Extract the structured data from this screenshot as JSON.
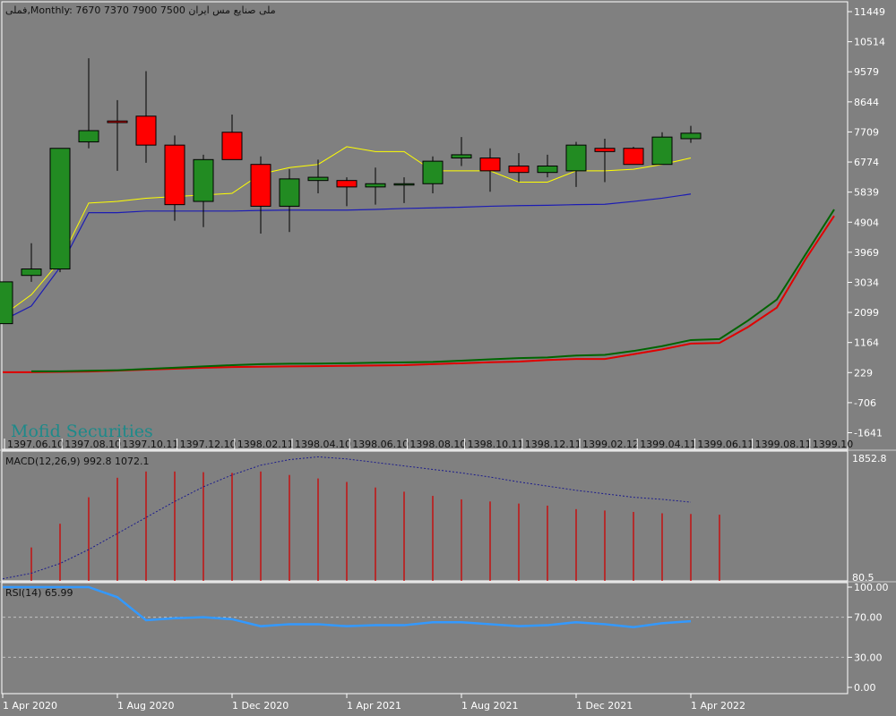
{
  "window": {
    "symbol_title": "فملی,Monthly:  7670 7370 7900 7500  ملی صنایع مس ایران",
    "watermark": "Mofid Securities"
  },
  "colors": {
    "background": "#808080",
    "bull": "#228b22",
    "bear": "#ff0000",
    "ma_fast": "#ffff00",
    "ma_slow": "#1c1cb4",
    "upper_bands_top": "#006400",
    "upper_bands_bottom": "#e00000",
    "macd_hist": "#cc0000",
    "macd_signal": "#1c1c8c",
    "rsi": "#3399ff"
  },
  "chart_data": [
    {
      "type": "candlestick",
      "panel": "price",
      "ylim": [
        -2100,
        11700
      ],
      "y_ticks": [
        11449,
        10514,
        9579,
        8644,
        7709,
        6774,
        5839,
        4904,
        3969,
        3034,
        2099,
        1164,
        229,
        -706,
        -1641
      ],
      "jalali_date_labels": [
        "1397.06.10",
        "1397.08.10",
        "1397.10.11",
        "1397.12.10",
        "1398.02.11",
        "1398.04.10",
        "1398.06.10",
        "1398.08.10",
        "1398.10.11",
        "1398.12.11",
        "1399.02.12",
        "1399.04.11",
        "1399.06.11",
        "1399.08.11",
        "1399.10"
      ],
      "candles": [
        {
          "open": 1750,
          "high": 3050,
          "low": 1750,
          "close": 3050
        },
        {
          "open": 3250,
          "high": 4250,
          "low": 3050,
          "close": 3450
        },
        {
          "open": 3450,
          "high": 7200,
          "low": 3350,
          "close": 7200
        },
        {
          "open": 7400,
          "high": 10000,
          "low": 7200,
          "close": 7750
        },
        {
          "open": 8050,
          "high": 8700,
          "low": 6500,
          "close": 8000
        },
        {
          "open": 8200,
          "high": 9600,
          "low": 6750,
          "close": 7300
        },
        {
          "open": 7300,
          "high": 7600,
          "low": 4950,
          "close": 5450
        },
        {
          "open": 5550,
          "high": 7000,
          "low": 4750,
          "close": 6850
        },
        {
          "open": 7700,
          "high": 8250,
          "low": 6850,
          "close": 6850
        },
        {
          "open": 6700,
          "high": 6950,
          "low": 4550,
          "close": 5400
        },
        {
          "open": 5400,
          "high": 6550,
          "low": 4600,
          "close": 6250
        },
        {
          "open": 6200,
          "high": 6850,
          "low": 5800,
          "close": 6300
        },
        {
          "open": 6200,
          "high": 6300,
          "low": 5400,
          "close": 6000
        },
        {
          "open": 6000,
          "high": 6600,
          "low": 5450,
          "close": 6100
        },
        {
          "open": 6100,
          "high": 6300,
          "low": 5500,
          "close": 6100
        },
        {
          "open": 6100,
          "high": 6950,
          "low": 5800,
          "close": 6800
        },
        {
          "open": 6900,
          "high": 7550,
          "low": 6650,
          "close": 7000
        },
        {
          "open": 6900,
          "high": 7200,
          "low": 5850,
          "close": 6500
        },
        {
          "open": 6650,
          "high": 7050,
          "low": 6150,
          "close": 6450
        },
        {
          "open": 6450,
          "high": 7000,
          "low": 6300,
          "close": 6650
        },
        {
          "open": 6500,
          "high": 7400,
          "low": 6000,
          "close": 7300
        },
        {
          "open": 7200,
          "high": 7500,
          "low": 6150,
          "close": 7100
        },
        {
          "open": 7200,
          "high": 7250,
          "low": 6700,
          "close": 6700
        },
        {
          "open": 6700,
          "high": 7700,
          "low": 6700,
          "close": 7550
        },
        {
          "open": 7500,
          "high": 7900,
          "low": 7370,
          "close": 7670
        }
      ],
      "ma_fast": [
        2000,
        2650,
        3700,
        5500,
        5550,
        5650,
        5700,
        5750,
        5800,
        6400,
        6600,
        6700,
        7250,
        7100,
        7100,
        6500,
        6500,
        6500,
        6150,
        6150,
        6500,
        6500,
        6550,
        6700,
        6900
      ],
      "ma_slow": [
        1850,
        2300,
        3500,
        5200,
        5200,
        5250,
        5250,
        5250,
        5250,
        5270,
        5280,
        5280,
        5280,
        5300,
        5330,
        5350,
        5370,
        5400,
        5420,
        5430,
        5450,
        5460,
        5550,
        5650,
        5780
      ],
      "band_x_start": 3,
      "band_top": [
        270,
        270,
        285,
        300,
        340,
        380,
        420,
        460,
        490,
        505,
        510,
        520,
        535,
        545,
        560,
        600,
        640,
        680,
        700,
        760,
        780,
        900,
        1050,
        1240,
        1270,
        1850,
        2500,
        3900,
        5300
      ],
      "band_bottom": [
        240,
        240,
        250,
        260,
        290,
        320,
        350,
        380,
        400,
        410,
        420,
        430,
        440,
        450,
        460,
        490,
        520,
        550,
        570,
        620,
        650,
        650,
        800,
        950,
        1130,
        1150,
        1650,
        2250,
        3750,
        5100
      ]
    },
    {
      "type": "bar",
      "panel": "macd",
      "title": "MACD(12,26,9) 992.8 1072.1",
      "ylim": [
        80.5,
        1852.8
      ],
      "y_ticks": [
        1852.8,
        80.5
      ],
      "values": [
        560,
        900,
        1280,
        1560,
        1650,
        1650,
        1640,
        1630,
        1650,
        1600,
        1550,
        1500,
        1420,
        1360,
        1300,
        1250,
        1220,
        1190,
        1160,
        1110,
        1090,
        1070,
        1050,
        1040,
        1030
      ],
      "signal": [
        110,
        190,
        330,
        530,
        760,
        990,
        1220,
        1430,
        1600,
        1740,
        1820,
        1860,
        1830,
        1780,
        1730,
        1680,
        1630,
        1570,
        1500,
        1440,
        1380,
        1330,
        1280,
        1250,
        1210
      ]
    },
    {
      "type": "line",
      "panel": "rsi",
      "title": "RSI(14) 65.99",
      "ylim": [
        0,
        100
      ],
      "y_ticks": [
        100.0,
        70.0,
        30.0,
        0.0
      ],
      "y_tick_labels": [
        "100.00",
        "70.00",
        "30.00",
        "0.00"
      ],
      "levels": [
        70,
        30
      ],
      "values": [
        100,
        100,
        100,
        100,
        90,
        67,
        69,
        70,
        68,
        61,
        63,
        63,
        61,
        62,
        62,
        65,
        65,
        63,
        61,
        62,
        65,
        63,
        60,
        64,
        65.99
      ]
    }
  ],
  "time_axis": {
    "labels": [
      "1 Apr 2020",
      "1 Aug 2020",
      "1 Dec 2020",
      "1 Apr 2021",
      "1 Aug 2021",
      "1 Dec 2021",
      "1 Apr 2022"
    ],
    "label_bar_index": [
      0,
      4,
      8,
      12,
      16,
      20,
      24
    ]
  }
}
